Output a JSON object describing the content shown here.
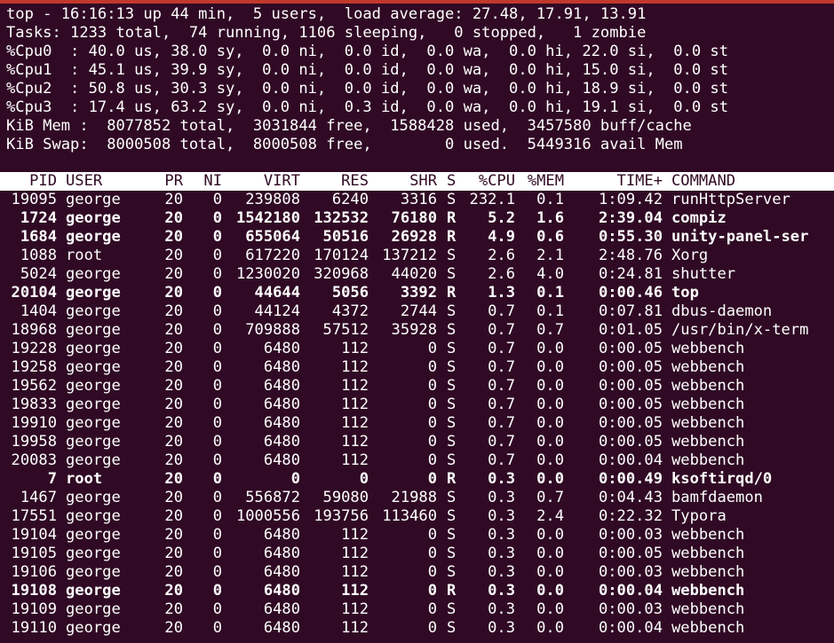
{
  "summary": {
    "line1": "top - 16:16:13 up 44 min,  5 users,  load average: 27.48, 17.91, 13.91",
    "line2": "Tasks: 1233 total,  74 running, 1106 sleeping,   0 stopped,   1 zombie",
    "cpu0": "%Cpu0  : 40.0 us, 38.0 sy,  0.0 ni,  0.0 id,  0.0 wa,  0.0 hi, 22.0 si,  0.0 st",
    "cpu1": "%Cpu1  : 45.1 us, 39.9 sy,  0.0 ni,  0.0 id,  0.0 wa,  0.0 hi, 15.0 si,  0.0 st",
    "cpu2": "%Cpu2  : 50.8 us, 30.3 sy,  0.0 ni,  0.0 id,  0.0 wa,  0.0 hi, 18.9 si,  0.0 st",
    "cpu3": "%Cpu3  : 17.4 us, 63.2 sy,  0.0 ni,  0.3 id,  0.0 wa,  0.0 hi, 19.1 si,  0.0 st",
    "mem": "KiB Mem :  8077852 total,  3031844 free,  1588428 used,  3457580 buff/cache",
    "swap": "KiB Swap:  8000508 total,  8000508 free,        0 used.  5449316 avail Mem"
  },
  "columns": [
    "PID",
    "USER",
    "PR",
    "NI",
    "VIRT",
    "RES",
    "SHR",
    "S",
    "%CPU",
    "%MEM",
    "TIME+",
    "COMMAND"
  ],
  "processes": [
    {
      "pid": "19095",
      "user": "george",
      "pr": "20",
      "ni": "0",
      "virt": "239808",
      "res": "6240",
      "shr": "3316",
      "s": "S",
      "cpu": "232.1",
      "mem": "0.1",
      "time": "1:09.42",
      "cmd": "runHttpServer"
    },
    {
      "pid": "1724",
      "user": "george",
      "pr": "20",
      "ni": "0",
      "virt": "1542180",
      "res": "132532",
      "shr": "76180",
      "s": "R",
      "cpu": "5.2",
      "mem": "1.6",
      "time": "2:39.04",
      "cmd": "compiz"
    },
    {
      "pid": "1684",
      "user": "george",
      "pr": "20",
      "ni": "0",
      "virt": "655064",
      "res": "50516",
      "shr": "26928",
      "s": "R",
      "cpu": "4.9",
      "mem": "0.6",
      "time": "0:55.30",
      "cmd": "unity-panel-ser"
    },
    {
      "pid": "1088",
      "user": "root",
      "pr": "20",
      "ni": "0",
      "virt": "617220",
      "res": "170124",
      "shr": "137212",
      "s": "S",
      "cpu": "2.6",
      "mem": "2.1",
      "time": "2:48.76",
      "cmd": "Xorg"
    },
    {
      "pid": "5024",
      "user": "george",
      "pr": "20",
      "ni": "0",
      "virt": "1230020",
      "res": "320968",
      "shr": "44020",
      "s": "S",
      "cpu": "2.6",
      "mem": "4.0",
      "time": "0:24.81",
      "cmd": "shutter"
    },
    {
      "pid": "20104",
      "user": "george",
      "pr": "20",
      "ni": "0",
      "virt": "44644",
      "res": "5056",
      "shr": "3392",
      "s": "R",
      "cpu": "1.3",
      "mem": "0.1",
      "time": "0:00.46",
      "cmd": "top"
    },
    {
      "pid": "1404",
      "user": "george",
      "pr": "20",
      "ni": "0",
      "virt": "44124",
      "res": "4372",
      "shr": "2744",
      "s": "S",
      "cpu": "0.7",
      "mem": "0.1",
      "time": "0:07.81",
      "cmd": "dbus-daemon"
    },
    {
      "pid": "18968",
      "user": "george",
      "pr": "20",
      "ni": "0",
      "virt": "709888",
      "res": "57512",
      "shr": "35928",
      "s": "S",
      "cpu": "0.7",
      "mem": "0.7",
      "time": "0:01.05",
      "cmd": "/usr/bin/x-term"
    },
    {
      "pid": "19228",
      "user": "george",
      "pr": "20",
      "ni": "0",
      "virt": "6480",
      "res": "112",
      "shr": "0",
      "s": "S",
      "cpu": "0.7",
      "mem": "0.0",
      "time": "0:00.05",
      "cmd": "webbench"
    },
    {
      "pid": "19258",
      "user": "george",
      "pr": "20",
      "ni": "0",
      "virt": "6480",
      "res": "112",
      "shr": "0",
      "s": "S",
      "cpu": "0.7",
      "mem": "0.0",
      "time": "0:00.05",
      "cmd": "webbench"
    },
    {
      "pid": "19562",
      "user": "george",
      "pr": "20",
      "ni": "0",
      "virt": "6480",
      "res": "112",
      "shr": "0",
      "s": "S",
      "cpu": "0.7",
      "mem": "0.0",
      "time": "0:00.05",
      "cmd": "webbench"
    },
    {
      "pid": "19833",
      "user": "george",
      "pr": "20",
      "ni": "0",
      "virt": "6480",
      "res": "112",
      "shr": "0",
      "s": "S",
      "cpu": "0.7",
      "mem": "0.0",
      "time": "0:00.05",
      "cmd": "webbench"
    },
    {
      "pid": "19910",
      "user": "george",
      "pr": "20",
      "ni": "0",
      "virt": "6480",
      "res": "112",
      "shr": "0",
      "s": "S",
      "cpu": "0.7",
      "mem": "0.0",
      "time": "0:00.05",
      "cmd": "webbench"
    },
    {
      "pid": "19958",
      "user": "george",
      "pr": "20",
      "ni": "0",
      "virt": "6480",
      "res": "112",
      "shr": "0",
      "s": "S",
      "cpu": "0.7",
      "mem": "0.0",
      "time": "0:00.05",
      "cmd": "webbench"
    },
    {
      "pid": "20083",
      "user": "george",
      "pr": "20",
      "ni": "0",
      "virt": "6480",
      "res": "112",
      "shr": "0",
      "s": "S",
      "cpu": "0.7",
      "mem": "0.0",
      "time": "0:00.04",
      "cmd": "webbench"
    },
    {
      "pid": "7",
      "user": "root",
      "pr": "20",
      "ni": "0",
      "virt": "0",
      "res": "0",
      "shr": "0",
      "s": "R",
      "cpu": "0.3",
      "mem": "0.0",
      "time": "0:00.49",
      "cmd": "ksoftirqd/0"
    },
    {
      "pid": "1467",
      "user": "george",
      "pr": "20",
      "ni": "0",
      "virt": "556872",
      "res": "59080",
      "shr": "21988",
      "s": "S",
      "cpu": "0.3",
      "mem": "0.7",
      "time": "0:04.43",
      "cmd": "bamfdaemon"
    },
    {
      "pid": "17551",
      "user": "george",
      "pr": "20",
      "ni": "0",
      "virt": "1000556",
      "res": "193756",
      "shr": "113460",
      "s": "S",
      "cpu": "0.3",
      "mem": "2.4",
      "time": "0:22.32",
      "cmd": "Typora"
    },
    {
      "pid": "19104",
      "user": "george",
      "pr": "20",
      "ni": "0",
      "virt": "6480",
      "res": "112",
      "shr": "0",
      "s": "S",
      "cpu": "0.3",
      "mem": "0.0",
      "time": "0:00.03",
      "cmd": "webbench"
    },
    {
      "pid": "19105",
      "user": "george",
      "pr": "20",
      "ni": "0",
      "virt": "6480",
      "res": "112",
      "shr": "0",
      "s": "S",
      "cpu": "0.3",
      "mem": "0.0",
      "time": "0:00.05",
      "cmd": "webbench"
    },
    {
      "pid": "19106",
      "user": "george",
      "pr": "20",
      "ni": "0",
      "virt": "6480",
      "res": "112",
      "shr": "0",
      "s": "S",
      "cpu": "0.3",
      "mem": "0.0",
      "time": "0:00.03",
      "cmd": "webbench"
    },
    {
      "pid": "19108",
      "user": "george",
      "pr": "20",
      "ni": "0",
      "virt": "6480",
      "res": "112",
      "shr": "0",
      "s": "R",
      "cpu": "0.3",
      "mem": "0.0",
      "time": "0:00.04",
      "cmd": "webbench"
    },
    {
      "pid": "19109",
      "user": "george",
      "pr": "20",
      "ni": "0",
      "virt": "6480",
      "res": "112",
      "shr": "0",
      "s": "S",
      "cpu": "0.3",
      "mem": "0.0",
      "time": "0:00.03",
      "cmd": "webbench"
    },
    {
      "pid": "19110",
      "user": "george",
      "pr": "20",
      "ni": "0",
      "virt": "6480",
      "res": "112",
      "shr": "0",
      "s": "S",
      "cpu": "0.3",
      "mem": "0.0",
      "time": "0:00.04",
      "cmd": "webbench"
    }
  ],
  "colors": {
    "background": "#300a24",
    "text": "#ffffff",
    "header_bg": "#ffffff",
    "header_text": "#300a24",
    "accent_line": "#c0392b"
  }
}
